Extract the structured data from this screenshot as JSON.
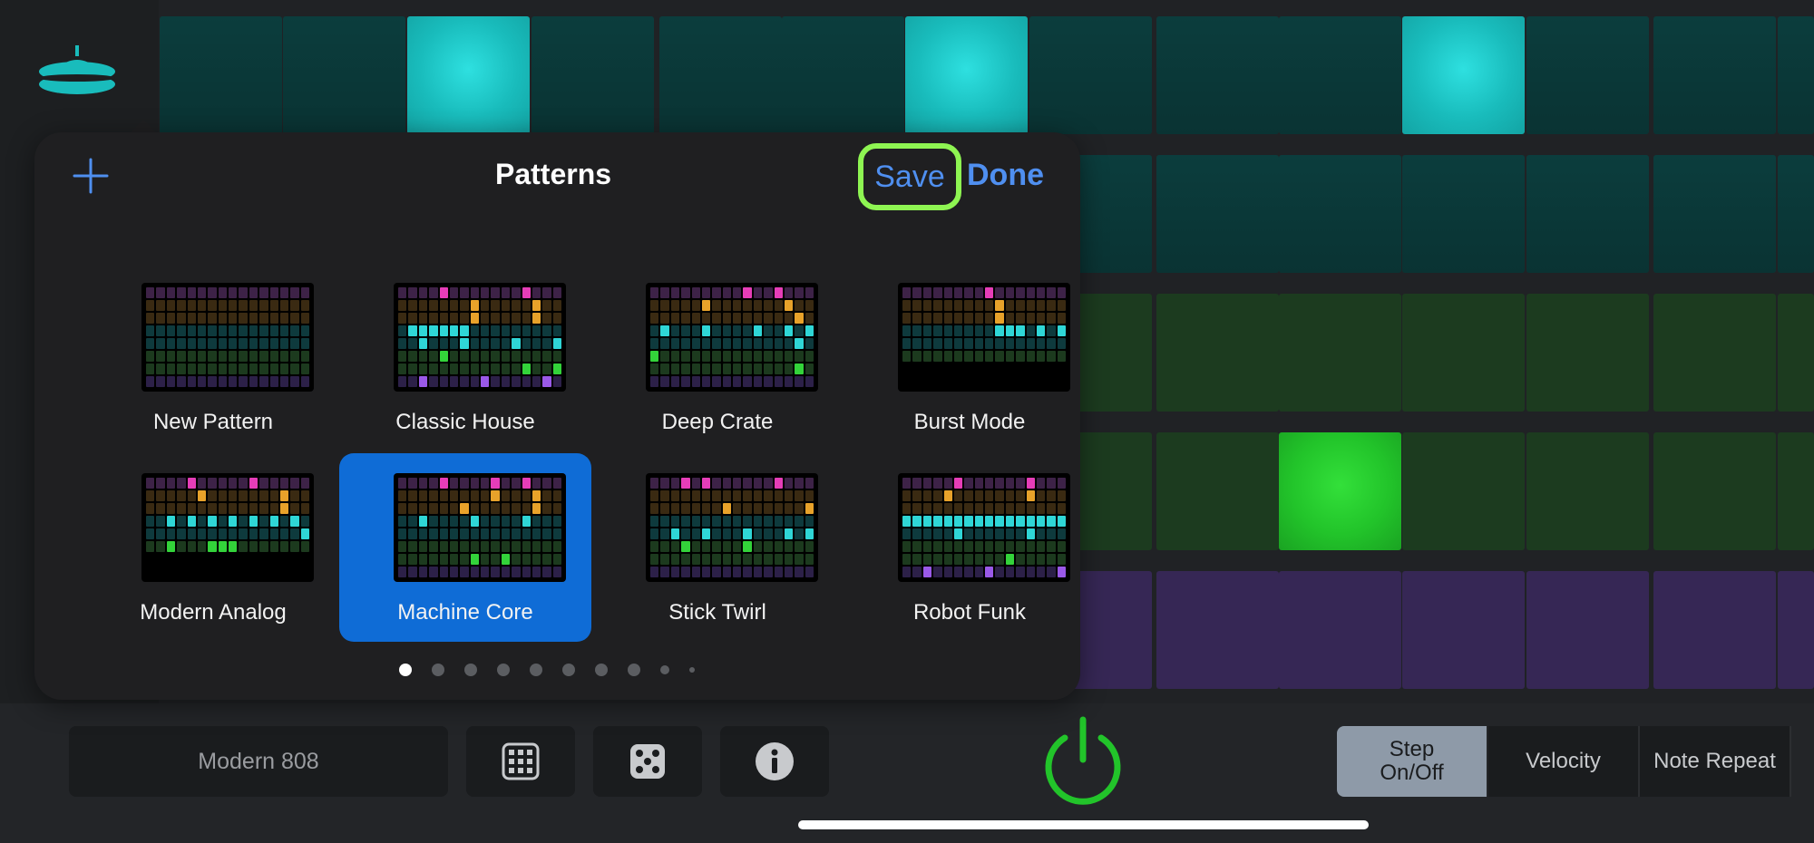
{
  "kit_name": "Modern 808",
  "panel": {
    "title": "Patterns",
    "save_label": "Save",
    "done_label": "Done"
  },
  "patterns": [
    {
      "name": "New Pattern",
      "selected": false
    },
    {
      "name": "Classic House",
      "selected": false
    },
    {
      "name": "Deep Crate",
      "selected": false
    },
    {
      "name": "Burst Mode",
      "selected": false
    },
    {
      "name": "Modern Analog",
      "selected": false
    },
    {
      "name": "Machine Core",
      "selected": true
    },
    {
      "name": "Stick Twirl",
      "selected": false
    },
    {
      "name": "Robot Funk",
      "selected": false
    }
  ],
  "page_indicator": {
    "count": 10,
    "active": 0
  },
  "modes": [
    "Step\nOn/Off",
    "Velocity",
    "Note Repeat"
  ],
  "selected_mode": "Step\nOn/Off",
  "step_grid": {
    "rows": 5,
    "lit": [
      [
        0,
        2
      ],
      [
        0,
        6
      ],
      [
        0,
        10
      ],
      [
        3,
        9
      ]
    ]
  },
  "icons": {
    "add": "plus-icon",
    "pattern_grid": "grid-icon",
    "randomize": "dice-icon",
    "info": "info-icon",
    "power": "power-icon",
    "instrument": "hihat-icon"
  },
  "colors": {
    "accent": "#4f8ff0",
    "highlight_ring": "#8ef552",
    "selection": "#0f6cd6",
    "power": "#22c42a",
    "cyan_row": "#19bcbc",
    "green_row": "#22c42a",
    "purple_row": "#362755"
  }
}
